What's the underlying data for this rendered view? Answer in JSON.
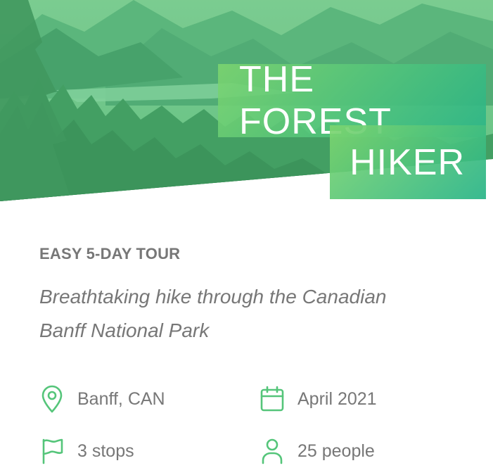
{
  "hero": {
    "title_line_1": "THE FOREST",
    "title_line_2": "HIKER"
  },
  "tour": {
    "heading": "EASY 5-DAY TOUR",
    "description": "Breathtaking hike through the Canadian Banff National Park"
  },
  "details": {
    "location": "Banff, CAN",
    "date": "April 2021",
    "stops": "3 stops",
    "people": "25 people"
  },
  "icons": {
    "location": "map-pin-icon",
    "date": "calendar-icon",
    "stops": "flag-icon",
    "people": "user-icon"
  },
  "colors": {
    "accent": "#55c57a",
    "accent_light": "#7ed56f",
    "accent_dark": "#28b485",
    "text": "#777777"
  }
}
